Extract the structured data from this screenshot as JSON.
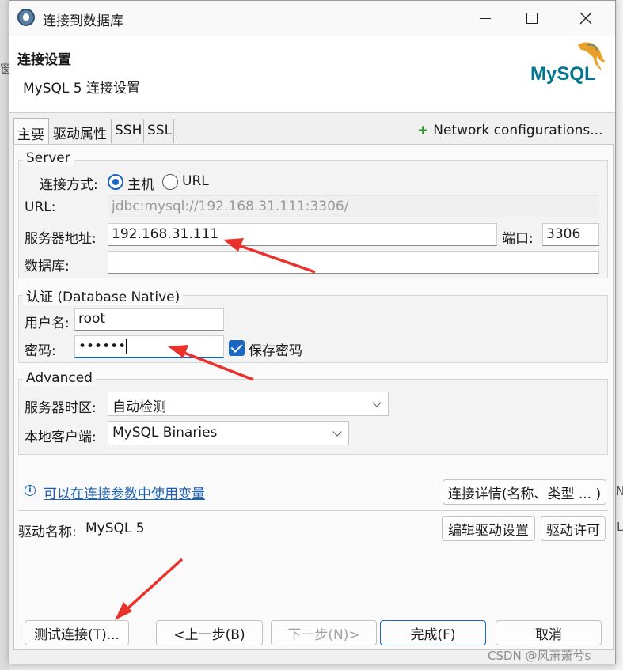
{
  "window": {
    "title": "连接到数据库"
  },
  "header": {
    "title": "连接设置",
    "subtitle": "MySQL 5 连接设置",
    "logo_text": "MySQL"
  },
  "tabs": [
    {
      "label": "主要"
    },
    {
      "label": "驱动属性"
    },
    {
      "label": "SSH"
    },
    {
      "label": "SSL"
    }
  ],
  "network": {
    "label": "Network configurations..."
  },
  "server": {
    "legend": "Server",
    "conn_mode_label": "连接方式:",
    "option_host": "主机",
    "option_url": "URL",
    "url_label": "URL:",
    "url_value": "jdbc:mysql://192.168.31.111:3306/",
    "host_label": "服务器地址:",
    "host_value": "192.168.31.111",
    "port_label": "端口:",
    "port_value": "3306",
    "db_label": "数据库:",
    "db_value": ""
  },
  "auth": {
    "legend": "认证 (Database Native)",
    "user_label": "用户名:",
    "user_value": "root",
    "pwd_label": "密码:",
    "pwd_value": "••••••",
    "save_pwd_label": "保存密码"
  },
  "advanced": {
    "legend": "Advanced",
    "timezone_label": "服务器时区:",
    "timezone_value": "自动检测",
    "client_label": "本地客户端:",
    "client_value": "MySQL Binaries"
  },
  "links": {
    "variables": "可以在连接参数中使用变量",
    "details_button": "连接详情(名称、类型 ... )"
  },
  "driver": {
    "label": "驱动名称:",
    "value": "MySQL 5",
    "edit_button": "编辑驱动设置",
    "license_button": "驱动许可"
  },
  "footer": {
    "test_button": "测试连接(T)...",
    "prev_button": "<上一步(B)",
    "next_button": "下一步(N)>",
    "finish_button": "完成(F)",
    "cancel_button": "取消"
  },
  "background": {
    "frag_left": "窗",
    "frag_right_n": "N",
    "frag_right_l": "L"
  },
  "watermark": "CSDN @风萧萧兮s",
  "colors": {
    "accent": "#1a66c2",
    "annotation_arrow": "#e8322b",
    "link": "#1a5fb4"
  }
}
